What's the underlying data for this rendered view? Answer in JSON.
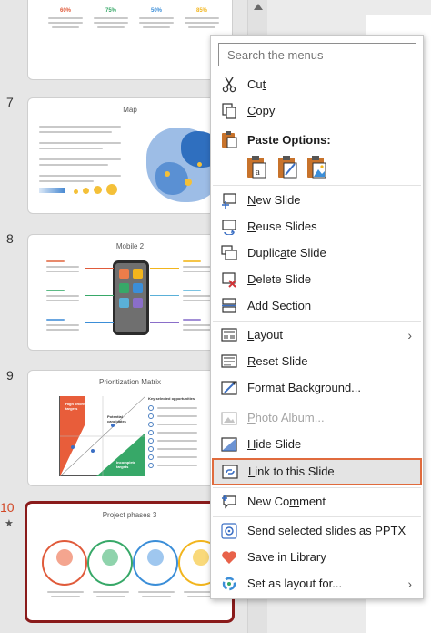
{
  "slides": [
    {
      "number": "7",
      "title": "Map"
    },
    {
      "number": "8",
      "title": "Mobile 2"
    },
    {
      "number": "9",
      "title": "Prioritization Matrix"
    },
    {
      "number": "10",
      "title": "Project phases 3"
    }
  ],
  "slide6_percents": [
    "60%",
    "75%",
    "50%",
    "85%"
  ],
  "matrix_labels": {
    "high_priority": "High priority targets",
    "potential": "Potential candidates",
    "incomplete": "Incomplete targets",
    "col_heading": "Key selected opportunities"
  },
  "menu": {
    "search_placeholder": "Search the menus",
    "cut": {
      "pre": "Cu",
      "acc": "t",
      "post": ""
    },
    "copy": {
      "pre": "",
      "acc": "C",
      "post": "opy"
    },
    "paste_options": "Paste Options:",
    "new_slide": {
      "pre": "",
      "acc": "N",
      "post": "ew Slide"
    },
    "reuse_slides": {
      "pre": "",
      "acc": "R",
      "post": "euse Slides"
    },
    "duplicate_slide": {
      "pre": "Duplic",
      "acc": "a",
      "post": "te Slide"
    },
    "delete_slide": {
      "pre": "",
      "acc": "D",
      "post": "elete Slide"
    },
    "add_section": {
      "pre": "",
      "acc": "A",
      "post": "dd Section"
    },
    "layout": {
      "pre": "",
      "acc": "L",
      "post": "ayout"
    },
    "reset_slide": {
      "pre": "",
      "acc": "R",
      "post": "eset Slide"
    },
    "format_background": {
      "pre": "Format ",
      "acc": "B",
      "post": "ackground..."
    },
    "photo_album": {
      "pre": "",
      "acc": "P",
      "post": "hoto Album..."
    },
    "hide_slide": {
      "pre": "",
      "acc": "H",
      "post": "ide Slide"
    },
    "link_to_slide": {
      "pre": "",
      "acc": "L",
      "post": "ink to this Slide"
    },
    "new_comment": {
      "pre": "New Co",
      "acc": "m",
      "post": "ment"
    },
    "send_pptx": "Send selected slides as PPTX",
    "save_library": "Save in Library",
    "set_layout": "Set as layout for...",
    "submenu_arrow": "›"
  },
  "colors": {
    "accent": "#d24726",
    "highlight_border": "#e06b3d",
    "selected_slide_border": "#8a1b1b"
  }
}
